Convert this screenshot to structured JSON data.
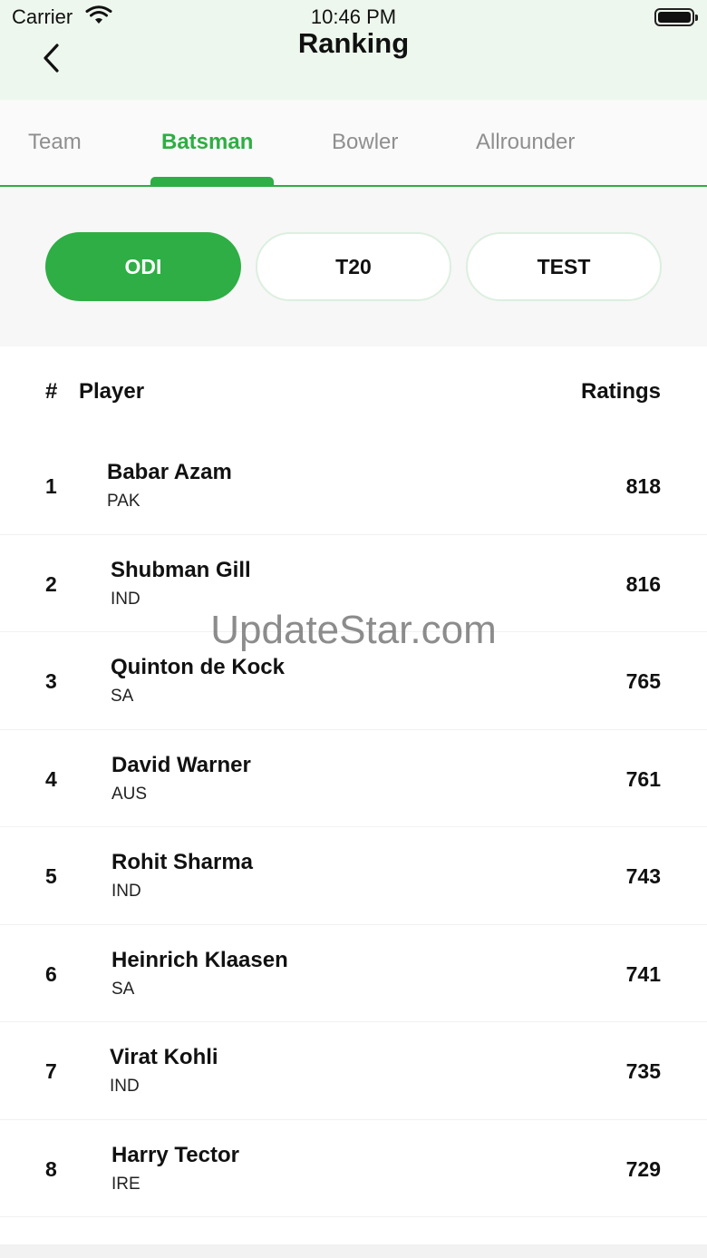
{
  "status_bar": {
    "carrier": "Carrier",
    "time": "10:46 PM"
  },
  "header": {
    "title": "Ranking"
  },
  "tabs": [
    {
      "label": "Team",
      "active": false
    },
    {
      "label": "Batsman",
      "active": true
    },
    {
      "label": "Bowler",
      "active": false
    },
    {
      "label": "Allrounder",
      "active": false
    }
  ],
  "formats": [
    {
      "label": "ODI",
      "active": true
    },
    {
      "label": "T20",
      "active": false
    },
    {
      "label": "TEST",
      "active": false
    }
  ],
  "table": {
    "col_rank": "#",
    "col_player": "Player",
    "col_ratings": "Ratings",
    "rows": [
      {
        "rank": "1",
        "name": "Babar Azam",
        "team": "PAK",
        "rating": "818"
      },
      {
        "rank": "2",
        "name": "Shubman Gill",
        "team": "IND",
        "rating": "816"
      },
      {
        "rank": "3",
        "name": "Quinton de Kock",
        "team": "SA",
        "rating": "765"
      },
      {
        "rank": "4",
        "name": "David Warner",
        "team": "AUS",
        "rating": "761"
      },
      {
        "rank": "5",
        "name": "Rohit Sharma",
        "team": "IND",
        "rating": "743"
      },
      {
        "rank": "6",
        "name": "Heinrich Klaasen",
        "team": "SA",
        "rating": "741"
      },
      {
        "rank": "7",
        "name": "Virat Kohli",
        "team": "IND",
        "rating": "735"
      },
      {
        "rank": "8",
        "name": "Harry Tector",
        "team": "IRE",
        "rating": "729"
      }
    ]
  },
  "watermark": "UpdateStar.com",
  "colors": {
    "accent": "#2eae44",
    "header_bg": "#eef7ee"
  },
  "icons": {
    "back": "chevron-left-icon",
    "wifi": "wifi-icon",
    "battery": "battery-icon"
  }
}
